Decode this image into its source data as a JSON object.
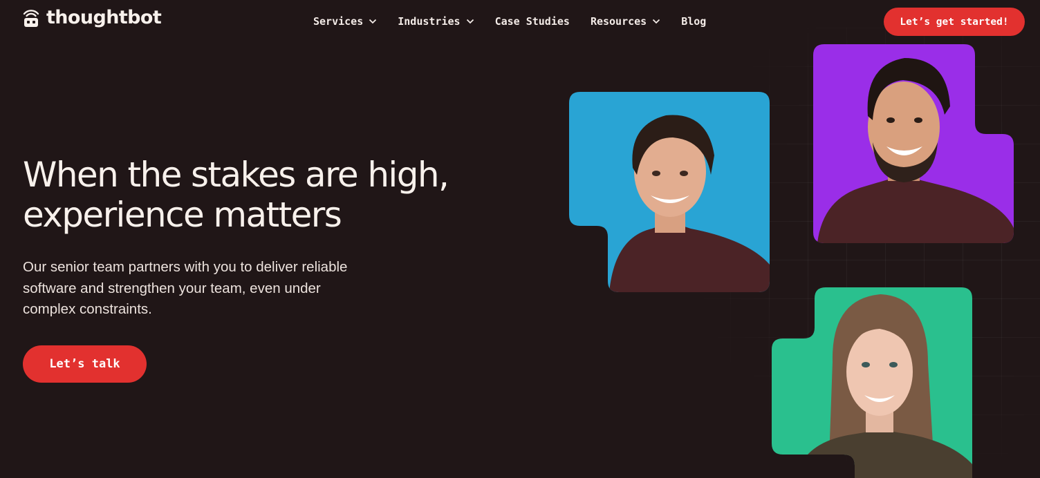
{
  "header": {
    "brand": "thoughtbot",
    "nav": [
      {
        "label": "Services",
        "has_dropdown": true
      },
      {
        "label": "Industries",
        "has_dropdown": true
      },
      {
        "label": "Case Studies",
        "has_dropdown": false
      },
      {
        "label": "Resources",
        "has_dropdown": true
      },
      {
        "label": "Blog",
        "has_dropdown": false
      }
    ],
    "cta_label": "Let’s get started!"
  },
  "hero": {
    "title_line1": "When the stakes are high,",
    "title_line2": "experience matters",
    "subtitle": "Our senior team partners with you to deliver reliable software and strengthen your team, even under complex constraints.",
    "cta_label": "Let’s talk"
  },
  "icons": {
    "logo": "robot-wifi-icon",
    "dropdown": "chevron-down-icon"
  },
  "colors": {
    "background": "#201617",
    "accent": "#e2312f",
    "portrait_blue": "#29a4d4",
    "portrait_purple": "#9a2ee8",
    "portrait_green": "#2ac08e",
    "shirt": "#4b2326"
  }
}
